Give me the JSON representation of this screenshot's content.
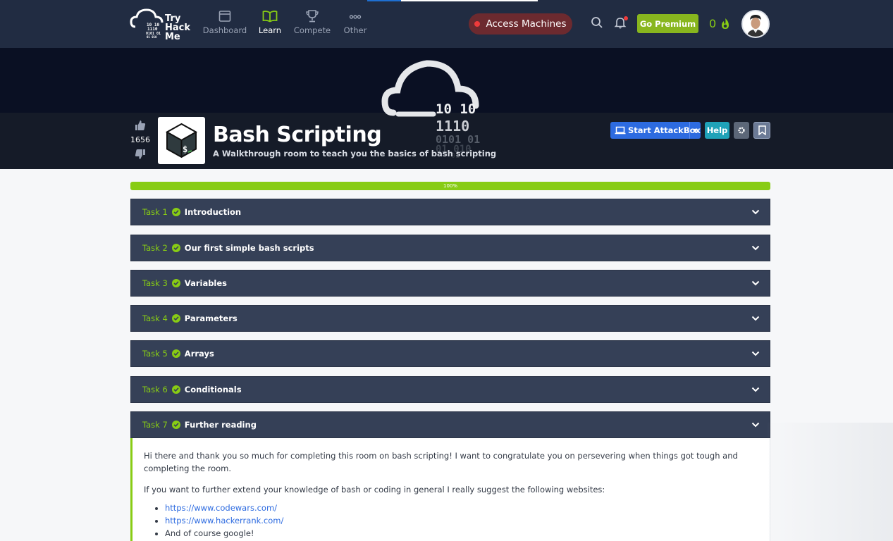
{
  "nav": {
    "logo": {
      "line1": "Try",
      "line2": "Hack",
      "line3": "Me",
      "bin1": "10  10",
      "bin2": "1110",
      "bin3": "0101  01",
      "bin4": "01  010"
    },
    "items": [
      {
        "label": "Dashboard",
        "icon": "dashboard-icon"
      },
      {
        "label": "Learn",
        "icon": "book-icon"
      },
      {
        "label": "Compete",
        "icon": "trophy-icon"
      },
      {
        "label": "Other",
        "icon": "dots-icon"
      }
    ],
    "access_label": "Access Machines",
    "premium_label": "Go Premium",
    "streak": "0"
  },
  "hero": {
    "bin1": "10  10",
    "bin2": "1110",
    "bin3": "0101  01",
    "bin4": "01  010",
    "bin5": "01"
  },
  "room": {
    "votes": "1656",
    "title": "Bash Scripting",
    "subtitle": "A Walkthrough room to teach you the basics of bash scripting",
    "attackbox_label": "Start AttackBox",
    "help_label": "Help",
    "progress_label": "100%",
    "progress": 1.0
  },
  "tasks": [
    {
      "num": "Task 1",
      "title": "Introduction"
    },
    {
      "num": "Task 2",
      "title": "Our first simple bash scripts"
    },
    {
      "num": "Task 3",
      "title": "Variables"
    },
    {
      "num": "Task 4",
      "title": "Parameters"
    },
    {
      "num": "Task 5",
      "title": "Arrays"
    },
    {
      "num": "Task 6",
      "title": "Conditionals"
    },
    {
      "num": "Task 7",
      "title": "Further reading"
    }
  ],
  "task7_body": {
    "p1": "Hi there and thank you so much for completing this room on bash scripting! I want to congratulate you on persevering when things got tough and completing the room.",
    "p2": "If you want to further extend your knowledge of bash or coding in general I really suggest the following websites:",
    "links": [
      "https://www.codewars.com/",
      "https://www.hackerrank.com/"
    ],
    "last_item": "And of course google!"
  },
  "colors": {
    "accent": "#88cc14",
    "navbar": "#212c42",
    "task_bg": "#354057",
    "attackbox": "#2d6be0",
    "help": "#1fa2b8"
  }
}
